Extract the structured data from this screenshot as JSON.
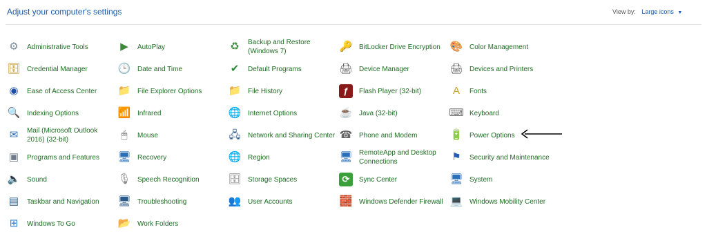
{
  "header": {
    "title": "Adjust your computer's settings",
    "view_by_label": "View by:",
    "view_by_value": "Large icons"
  },
  "columns": [
    [
      {
        "label": "Administrative Tools",
        "icon": "administrative-tools-icon",
        "glyph": "⚙",
        "color": "#7a8a9a"
      },
      {
        "label": "Credential Manager",
        "icon": "credential-manager-icon",
        "glyph": "🗄",
        "color": "#b8860b"
      },
      {
        "label": "Ease of Access Center",
        "icon": "ease-of-access-icon",
        "glyph": "◉",
        "color": "#1e4fa8"
      },
      {
        "label": "Indexing Options",
        "icon": "indexing-options-icon",
        "glyph": "🔍",
        "color": "#6c7a89"
      },
      {
        "label": "Mail (Microsoft Outlook 2016) (32-bit)",
        "icon": "mail-icon",
        "glyph": "✉",
        "color": "#2a6fb8"
      },
      {
        "label": "Programs and Features",
        "icon": "programs-features-icon",
        "glyph": "▣",
        "color": "#6c7a89"
      },
      {
        "label": "Sound",
        "icon": "sound-icon",
        "glyph": "🔈",
        "color": "#7a8a9a"
      },
      {
        "label": "Taskbar and Navigation",
        "icon": "taskbar-navigation-icon",
        "glyph": "▤",
        "color": "#2a5a8a"
      },
      {
        "label": "Windows To Go",
        "icon": "windows-to-go-icon",
        "glyph": "⊞",
        "color": "#2a7ad0"
      }
    ],
    [
      {
        "label": "AutoPlay",
        "icon": "autoplay-icon",
        "glyph": "▶",
        "color": "#3a8a3a"
      },
      {
        "label": "Date and Time",
        "icon": "date-time-icon",
        "glyph": "🕒",
        "color": "#4a7ab0"
      },
      {
        "label": "File Explorer Options",
        "icon": "file-explorer-options-icon",
        "glyph": "📁",
        "color": "#d8b040"
      },
      {
        "label": "Infrared",
        "icon": "infrared-icon",
        "glyph": "📶",
        "color": "#b03030"
      },
      {
        "label": "Mouse",
        "icon": "mouse-icon",
        "glyph": "🖱",
        "color": "#555"
      },
      {
        "label": "Recovery",
        "icon": "recovery-icon",
        "glyph": "🖥",
        "color": "#2a6fb8"
      },
      {
        "label": "Speech Recognition",
        "icon": "speech-recognition-icon",
        "glyph": "🎙",
        "color": "#888"
      },
      {
        "label": "Troubleshooting",
        "icon": "troubleshooting-icon",
        "glyph": "🖥",
        "color": "#2a5a8a"
      },
      {
        "label": "Work Folders",
        "icon": "work-folders-icon",
        "glyph": "📂",
        "color": "#d8b040"
      }
    ],
    [
      {
        "label": "Backup and Restore (Windows 7)",
        "icon": "backup-restore-icon",
        "glyph": "♻",
        "color": "#3a8a3a"
      },
      {
        "label": "Default Programs",
        "icon": "default-programs-icon",
        "glyph": "✔",
        "color": "#2a8a3a"
      },
      {
        "label": "File History",
        "icon": "file-history-icon",
        "glyph": "📁",
        "color": "#d8b040"
      },
      {
        "label": "Internet Options",
        "icon": "internet-options-icon",
        "glyph": "🌐",
        "color": "#2a8a3a"
      },
      {
        "label": "Network and Sharing Center",
        "icon": "network-sharing-icon",
        "glyph": "🖧",
        "color": "#2a5a8a"
      },
      {
        "label": "Region",
        "icon": "region-icon",
        "glyph": "🌐",
        "color": "#6a8ab0"
      },
      {
        "label": "Storage Spaces",
        "icon": "storage-spaces-icon",
        "glyph": "🗄",
        "color": "#777"
      },
      {
        "label": "User Accounts",
        "icon": "user-accounts-icon",
        "glyph": "👥",
        "color": "#3a6a9a"
      }
    ],
    [
      {
        "label": "BitLocker Drive Encryption",
        "icon": "bitlocker-icon",
        "glyph": "🔑",
        "color": "#9a8a5a"
      },
      {
        "label": "Device Manager",
        "icon": "device-manager-icon",
        "glyph": "🖨",
        "color": "#555"
      },
      {
        "label": "Flash Player (32-bit)",
        "icon": "flash-player-icon",
        "glyph": "ƒ",
        "color": "#ffffff",
        "bg": "#8a1a1a"
      },
      {
        "label": "Java (32-bit)",
        "icon": "java-icon",
        "glyph": "☕",
        "color": "#c05020"
      },
      {
        "label": "Phone and Modem",
        "icon": "phone-modem-icon",
        "glyph": "☎",
        "color": "#666"
      },
      {
        "label": "RemoteApp and Desktop Connections",
        "icon": "remoteapp-icon",
        "glyph": "🖥",
        "color": "#2a6fb8"
      },
      {
        "label": "Sync Center",
        "icon": "sync-center-icon",
        "glyph": "⟳",
        "color": "#ffffff",
        "bg": "#3aa03a"
      },
      {
        "label": "Windows Defender Firewall",
        "icon": "firewall-icon",
        "glyph": "🧱",
        "color": "#a04020"
      }
    ],
    [
      {
        "label": "Color Management",
        "icon": "color-management-icon",
        "glyph": "🎨",
        "color": "#d04040"
      },
      {
        "label": "Devices and Printers",
        "icon": "devices-printers-icon",
        "glyph": "🖨",
        "color": "#555"
      },
      {
        "label": "Fonts",
        "icon": "fonts-icon",
        "glyph": "A",
        "color": "#c8a030"
      },
      {
        "label": "Keyboard",
        "icon": "keyboard-icon",
        "glyph": "⌨",
        "color": "#777"
      },
      {
        "label": "Power Options",
        "icon": "power-options-icon",
        "glyph": "🔋",
        "color": "#3a8a3a"
      },
      {
        "label": "Security and Maintenance",
        "icon": "security-maintenance-icon",
        "glyph": "⚑",
        "color": "#2a5ab8"
      },
      {
        "label": "System",
        "icon": "system-icon",
        "glyph": "🖥",
        "color": "#2a6fb8"
      },
      {
        "label": "Windows Mobility Center",
        "icon": "mobility-center-icon",
        "glyph": "💻",
        "color": "#555"
      }
    ]
  ],
  "annotation": {
    "arrow_target": "Power Options"
  }
}
